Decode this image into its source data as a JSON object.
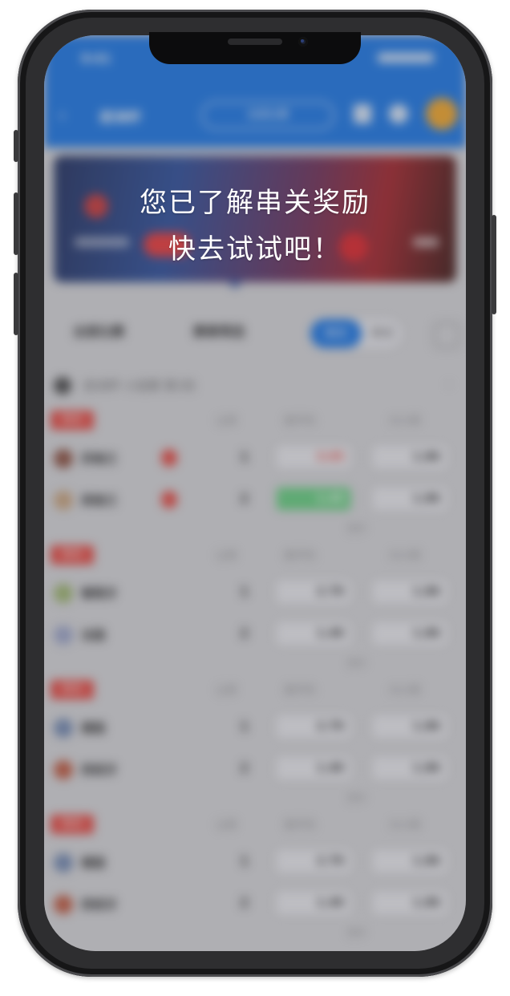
{
  "overlay": {
    "line1": "您已了解串关奖励",
    "line2": "快去试试吧！"
  },
  "app_blurred": {
    "status_time": "9:41",
    "header_title": "欧洲杯",
    "header_select": "全部比赛",
    "filters": {
      "left": "全部比赛",
      "middle": "赛事筛选",
      "toggle_on": "串关",
      "toggle_off": "单关"
    },
    "league": {
      "title": "欧洲杯 小组赛 第1轮",
      "arrow": "›"
    },
    "matches": [
      {
        "tag": "串关",
        "h1": "让球",
        "h2": "胜平负",
        "h3": "大小球",
        "team1": "苏格兰",
        "team2": "英格兰",
        "n1": "1",
        "n2": "2",
        "o1a": "3.05",
        "o1b": "1.86",
        "o2a": "1.45",
        "o2b": "1.86",
        "more": "更多"
      },
      {
        "tag": "串关",
        "h1": "让球",
        "h2": "胜平负",
        "h3": "大小球",
        "team1": "葡萄牙",
        "team2": "法国",
        "n1": "1",
        "n2": "2",
        "o1a": "2.70",
        "o1b": "1.86",
        "o2a": "1.40",
        "o2b": "1.86",
        "more": "更多"
      },
      {
        "tag": "串关",
        "h1": "让球",
        "h2": "胜平负",
        "h3": "大小球",
        "team1": "德国",
        "team2": "西班牙",
        "n1": "1",
        "n2": "2",
        "o1a": "2.70",
        "o1b": "1.86",
        "o2a": "1.40",
        "o2b": "1.86",
        "more": "更多"
      },
      {
        "tag": "串关",
        "h1": "让球",
        "h2": "胜平负",
        "h3": "大小球",
        "team1": "德国",
        "team2": "西班牙",
        "n1": "1",
        "n2": "2",
        "o1a": "2.70",
        "o1b": "1.86",
        "o2a": "1.40",
        "o2b": "1.86",
        "more": "更多"
      }
    ]
  },
  "colors": {
    "accent": "#1474e8",
    "tag_red": "#e8423a",
    "odd_green": "#62d07d"
  }
}
